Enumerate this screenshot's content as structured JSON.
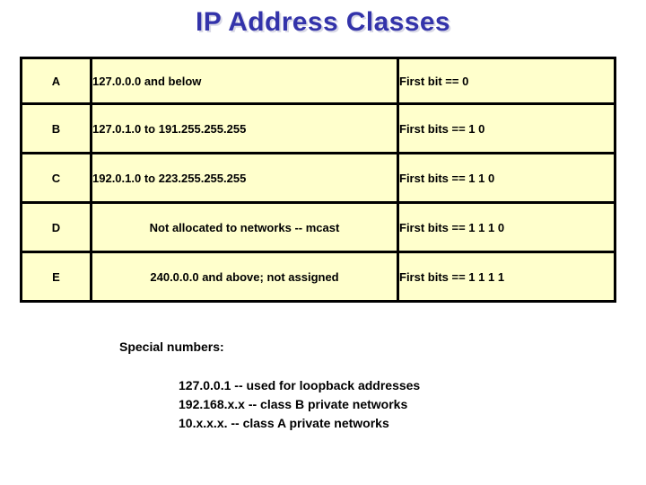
{
  "slide": {
    "title": "IP Address Classes",
    "title_color": "#3333aa",
    "background_color": "#ffffff",
    "cell_background_color": "#ffffcc",
    "border_color": "#000000"
  },
  "table": {
    "columns": [
      "class",
      "range",
      "bits"
    ],
    "rows": [
      {
        "class": "A",
        "range": "127.0.0.0  and below",
        "bits": "First bit == 0"
      },
      {
        "class": "B",
        "range": "127.0.1.0  to  191.255.255.255",
        "bits": "First bits == 1 0"
      },
      {
        "class": "C",
        "range": "192.0.1.0 to 223.255.255.255",
        "bits": "First bits == 1 1 0"
      },
      {
        "class": "D",
        "range": "Not allocated to networks -- mcast",
        "bits": "First bits ==  1 1 1 0"
      },
      {
        "class": "E",
        "range": "240.0.0.0 and above; not assigned",
        "bits": "First bits ==  1 1 1 1"
      }
    ]
  },
  "special": {
    "heading": "Special numbers:",
    "lines": [
      "127.0.0.1 -- used for loopback addresses",
      "192.168.x.x -- class B private networks",
      "10.x.x.x. -- class A private networks"
    ]
  }
}
